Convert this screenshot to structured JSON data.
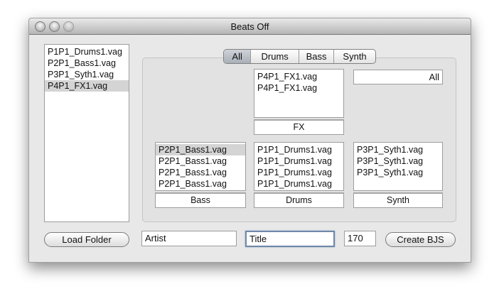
{
  "window": {
    "title": "Beats Off"
  },
  "file_list": [
    "P1P1_Drums1.vag",
    "P2P1_Bass1.vag",
    "P3P1_Syth1.vag",
    "P4P1_FX1.vag"
  ],
  "file_list_selected": 3,
  "tabs": [
    "All",
    "Drums",
    "Bass",
    "Synth"
  ],
  "active_tab": "All",
  "filter_field": "All",
  "fx": {
    "items": [
      "P4P1_FX1.vag",
      "P4P1_FX1.vag"
    ],
    "label": "FX"
  },
  "bass": {
    "items": [
      "P2P1_Bass1.vag",
      "P2P1_Bass1.vag",
      "P2P1_Bass1.vag",
      "P2P1_Bass1.vag"
    ],
    "label": "Bass"
  },
  "drums": {
    "items": [
      "P1P1_Drums1.vag",
      "P1P1_Drums1.vag",
      "P1P1_Drums1.vag",
      "P1P1_Drums1.vag"
    ],
    "label": "Drums"
  },
  "synth": {
    "items": [
      "P3P1_Syth1.vag",
      "P3P1_Syth1.vag",
      "P3P1_Syth1.vag"
    ],
    "label": "Synth"
  },
  "bottom": {
    "load_folder": "Load Folder",
    "artist": "Artist",
    "title": "Title",
    "tempo": "170",
    "create": "Create BJS"
  }
}
